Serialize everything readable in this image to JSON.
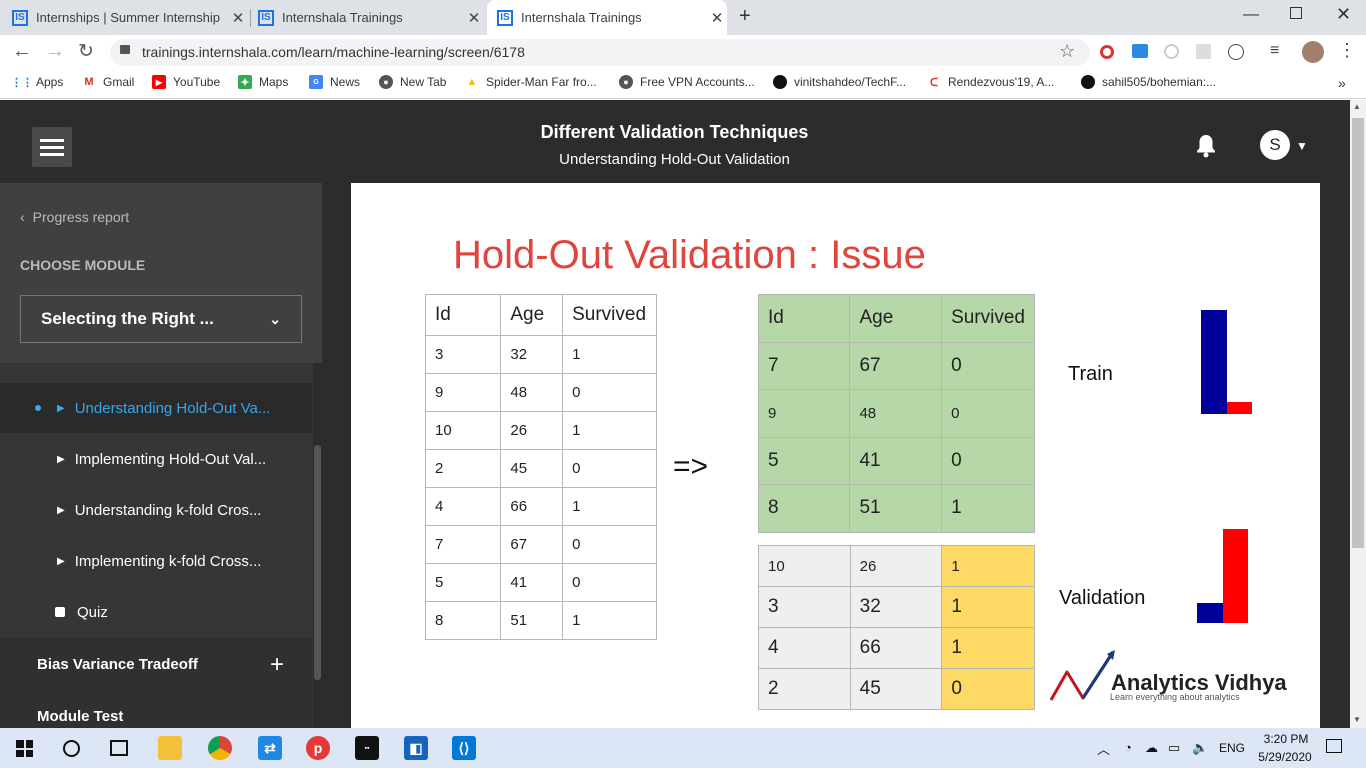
{
  "browser": {
    "tabs": [
      {
        "title": "Internships | Summer Internship",
        "active": false
      },
      {
        "title": "Internshala Trainings",
        "active": false
      },
      {
        "title": "Internshala Trainings",
        "active": true
      }
    ],
    "url": "trainings.internshala.com/learn/machine-learning/screen/6178",
    "bookmarks": [
      {
        "label": "Apps",
        "icon": "apps-grid-icon"
      },
      {
        "label": "Gmail",
        "icon": "gmail-icon"
      },
      {
        "label": "YouTube",
        "icon": "youtube-icon"
      },
      {
        "label": "Maps",
        "icon": "maps-icon"
      },
      {
        "label": "News",
        "icon": "news-icon"
      },
      {
        "label": "New Tab",
        "icon": "globe-icon"
      },
      {
        "label": "Spider-Man Far fro...",
        "icon": "drive-icon"
      },
      {
        "label": "Free VPN Accounts...",
        "icon": "globe-icon"
      },
      {
        "label": "vinitshahdeo/TechF...",
        "icon": "github-icon"
      },
      {
        "label": "Rendezvous'19, A...",
        "icon": "rendezvous-icon"
      },
      {
        "label": "sahil505/bohemian:...",
        "icon": "github-icon"
      }
    ],
    "bookmarks_overflow": "»"
  },
  "header": {
    "title": "Different Validation Techniques",
    "subtitle": "Understanding Hold-Out Validation",
    "avatar_letter": "S"
  },
  "sidebar": {
    "progress_label": "Progress report",
    "choose_label": "CHOOSE MODULE",
    "selected_module": "Selecting the Right ...",
    "items": [
      {
        "label": "Understanding Hold-Out Va...",
        "active": true
      },
      {
        "label": "Implementing Hold-Out Val...",
        "active": false
      },
      {
        "label": "Understanding k-fold Cros...",
        "active": false
      },
      {
        "label": "Implementing k-fold Cross...",
        "active": false
      },
      {
        "label": "Quiz",
        "active": false
      }
    ],
    "modules": [
      "Bias Variance Tradeoff",
      "Module Test"
    ]
  },
  "slide": {
    "title": "Hold-Out Validation : Issue",
    "table_full": {
      "headers": [
        "Id",
        "Age",
        "Survived"
      ],
      "rows": [
        [
          "3",
          "32",
          "1"
        ],
        [
          "9",
          "48",
          "0"
        ],
        [
          "10",
          "26",
          "1"
        ],
        [
          "2",
          "45",
          "0"
        ],
        [
          "4",
          "66",
          "1"
        ],
        [
          "7",
          "67",
          "0"
        ],
        [
          "5",
          "41",
          "0"
        ],
        [
          "8",
          "51",
          "1"
        ]
      ]
    },
    "arrow": "=>",
    "table_train": {
      "headers": [
        "Id",
        "Age",
        "Survived"
      ],
      "rows": [
        [
          "7",
          "67",
          "0"
        ],
        [
          "9",
          "48",
          "0"
        ],
        [
          "5",
          "41",
          "0"
        ],
        [
          "8",
          "51",
          "1"
        ]
      ]
    },
    "table_validation": {
      "rows": [
        [
          "10",
          "26",
          "1"
        ],
        [
          "3",
          "32",
          "1"
        ],
        [
          "4",
          "66",
          "1"
        ],
        [
          "2",
          "45",
          "0"
        ]
      ]
    },
    "train_label": "Train",
    "validation_label": "Validation",
    "logo_name": "Analytics Vidhya",
    "logo_tagline": "Learn everything about analytics",
    "colors": {
      "blue": "#000099",
      "red": "#ff0000",
      "title": "#e0443a",
      "green": "#b6d7a8",
      "yellow": "#ffd966"
    }
  },
  "taskbar": {
    "language": "ENG",
    "time": "3:20 PM",
    "date": "5/29/2020"
  }
}
